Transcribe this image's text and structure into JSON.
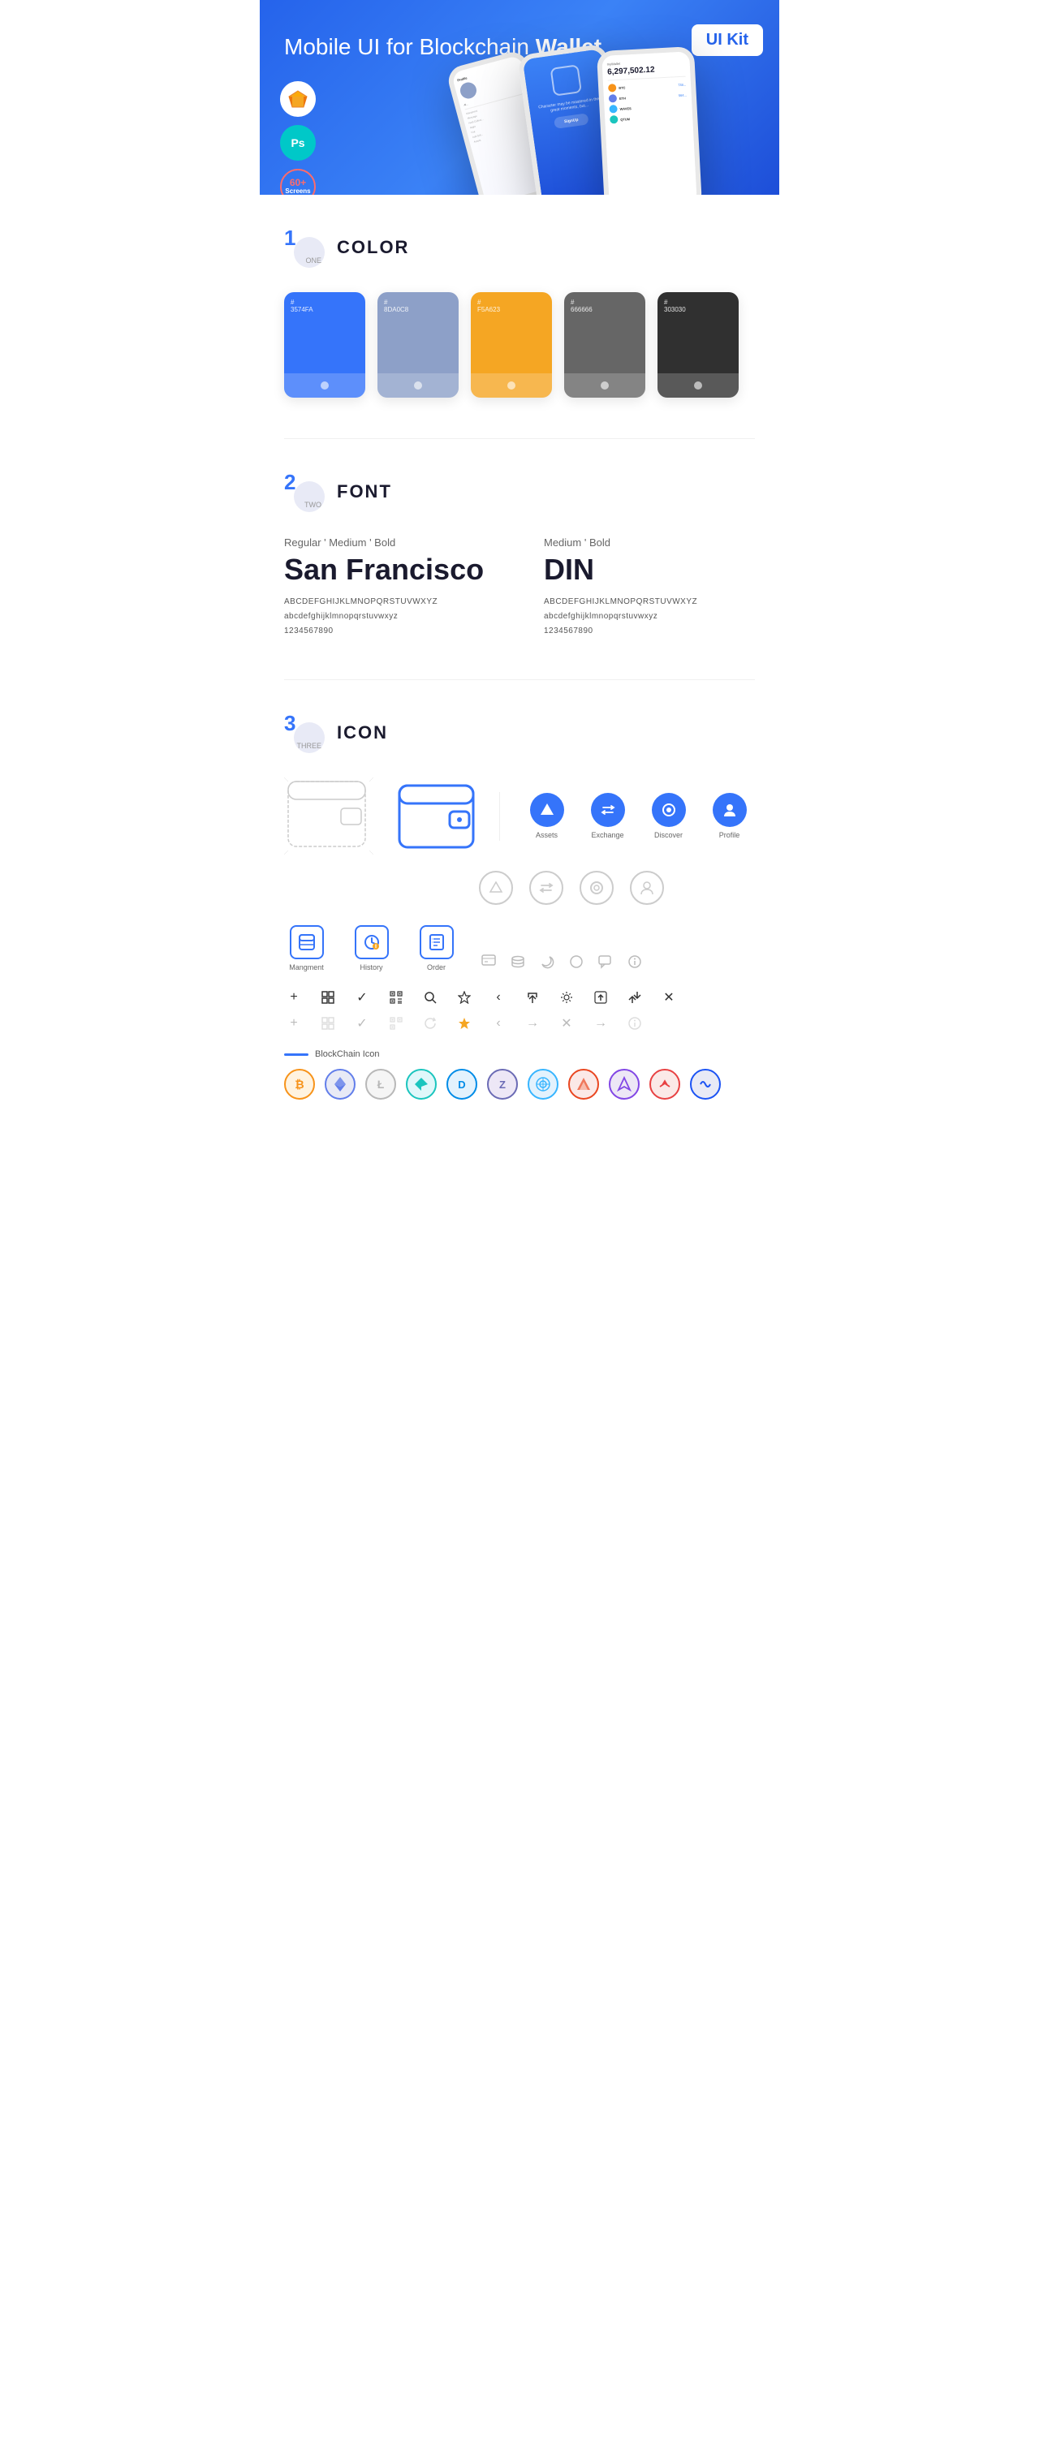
{
  "hero": {
    "title_regular": "Mobile UI for Blockchain ",
    "title_bold": "Wallet",
    "badge": "UI Kit",
    "tools": [
      {
        "name": "Sketch",
        "symbol": "💎"
      },
      {
        "name": "Photoshop",
        "symbol": "Ps"
      },
      {
        "name": "60+",
        "sub": "Screens"
      }
    ]
  },
  "sections": {
    "color": {
      "number": "1",
      "sub": "ONE",
      "title": "COLOR",
      "swatches": [
        {
          "hex": "#3574FA",
          "code": "#\n3574FA",
          "dark": false
        },
        {
          "hex": "#8DA0C8",
          "code": "#\n8DA0C8",
          "dark": false
        },
        {
          "hex": "#F5A623",
          "code": "#\nF5A623",
          "dark": false
        },
        {
          "hex": "#666666",
          "code": "#\n666666",
          "dark": false
        },
        {
          "hex": "#303030",
          "code": "#\n303030",
          "dark": false
        }
      ]
    },
    "font": {
      "number": "2",
      "sub": "TWO",
      "title": "FONT",
      "fonts": [
        {
          "styles": "Regular ' Medium ' Bold",
          "name": "San Francisco",
          "uppercase": "ABCDEFGHIJKLMNOPQRSTUVWXYZ",
          "lowercase": "abcdefghijklmnopqrstuvwxyz",
          "numbers": "1234567890"
        },
        {
          "styles": "Medium ' Bold",
          "name": "DIN",
          "uppercase": "ABCDEFGHIJKLMNOPQRSTUVWXYZ",
          "lowercase": "abcdefghijklmnopqrstuvwxyz",
          "numbers": "1234567890"
        }
      ]
    },
    "icon": {
      "number": "3",
      "sub": "THREE",
      "title": "ICON",
      "nav_icons": [
        {
          "label": "Assets",
          "symbol": "◆"
        },
        {
          "label": "Exchange",
          "symbol": "⇄"
        },
        {
          "label": "Discover",
          "symbol": "●"
        },
        {
          "label": "Profile",
          "symbol": "👤"
        }
      ],
      "app_icons": [
        {
          "label": "Mangment",
          "symbol": "▣"
        },
        {
          "label": "History",
          "symbol": "🕐"
        },
        {
          "label": "Order",
          "symbol": "📋"
        }
      ],
      "utility_icons_row1": [
        "+",
        "⊞",
        "✓",
        "⊟",
        "🔍",
        "☆",
        "‹",
        "⇤",
        "⚙",
        "⊠",
        "⇌",
        "✕"
      ],
      "utility_icons_row2": [
        "+",
        "⊞",
        "✓",
        "⊟",
        "↻",
        "★",
        "‹",
        "→",
        "✕",
        "→",
        "ⓘ"
      ],
      "blockchain_label": "BlockChain Icon",
      "crypto": [
        {
          "symbol": "₿",
          "color": "#F7931A",
          "bg": "#fff3e0",
          "border": "#F7931A"
        },
        {
          "symbol": "Ξ",
          "color": "#627EEA",
          "bg": "#e8eaf6",
          "border": "#627EEA"
        },
        {
          "symbol": "Ł",
          "color": "#B8B8B8",
          "bg": "#f5f5f5",
          "border": "#B8B8B8"
        },
        {
          "symbol": "◆",
          "color": "#1BC5BE",
          "bg": "#e0f7fa",
          "border": "#1BC5BE"
        },
        {
          "symbol": "D",
          "color": "#008CE7",
          "bg": "#e3f2fd",
          "border": "#008CE7"
        },
        {
          "symbol": "Z",
          "color": "#6B6BB5",
          "bg": "#ede7f6",
          "border": "#6B6BB5"
        },
        {
          "symbol": "⬡",
          "color": "#37B5FF",
          "bg": "#e3f2fd",
          "border": "#37B5FF"
        },
        {
          "symbol": "▲",
          "color": "#E94620",
          "bg": "#fbe9e7",
          "border": "#E94620"
        },
        {
          "symbol": "◇",
          "color": "#8247E5",
          "bg": "#ede7f6",
          "border": "#8247E5"
        },
        {
          "symbol": "⋈",
          "color": "#E84142",
          "bg": "#fbe9e7",
          "border": "#E84142"
        },
        {
          "symbol": "∞",
          "color": "#1B53F4",
          "bg": "#e8eaf6",
          "border": "#1B53F4"
        }
      ]
    }
  }
}
